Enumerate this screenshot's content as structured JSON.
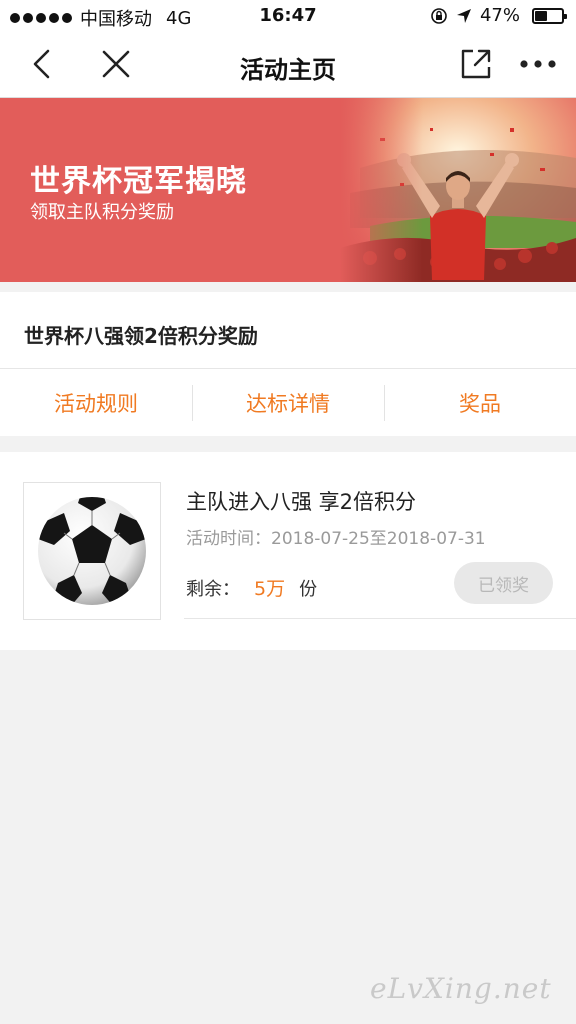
{
  "status_bar": {
    "carrier": "中国移动",
    "network": "4G",
    "time": "16:47",
    "battery": "47%",
    "battery_level": 0.47
  },
  "nav": {
    "title": "活动主页",
    "icons": [
      "back-icon",
      "close-icon",
      "share-icon",
      "more-icon"
    ]
  },
  "banner": {
    "title": "世界杯冠军揭晓",
    "subtitle": "领取主队积分奖励",
    "background_color": "#e25d5a"
  },
  "activity": {
    "title": "世界杯八强领2倍积分奖励",
    "tabs": [
      {
        "label": "活动规则"
      },
      {
        "label": "达标详情"
      },
      {
        "label": "奖品"
      }
    ],
    "accent_color": "#f07a22"
  },
  "reward": {
    "name": "主队进入八强 享2倍积分",
    "time_label": "活动时间：",
    "time_range": "2018-07-25至2018-07-31",
    "remain_label": "剩余：",
    "remain_value": "5万",
    "remain_unit": "份",
    "button_label": "已领奖"
  },
  "watermark": "eLvXing.net"
}
